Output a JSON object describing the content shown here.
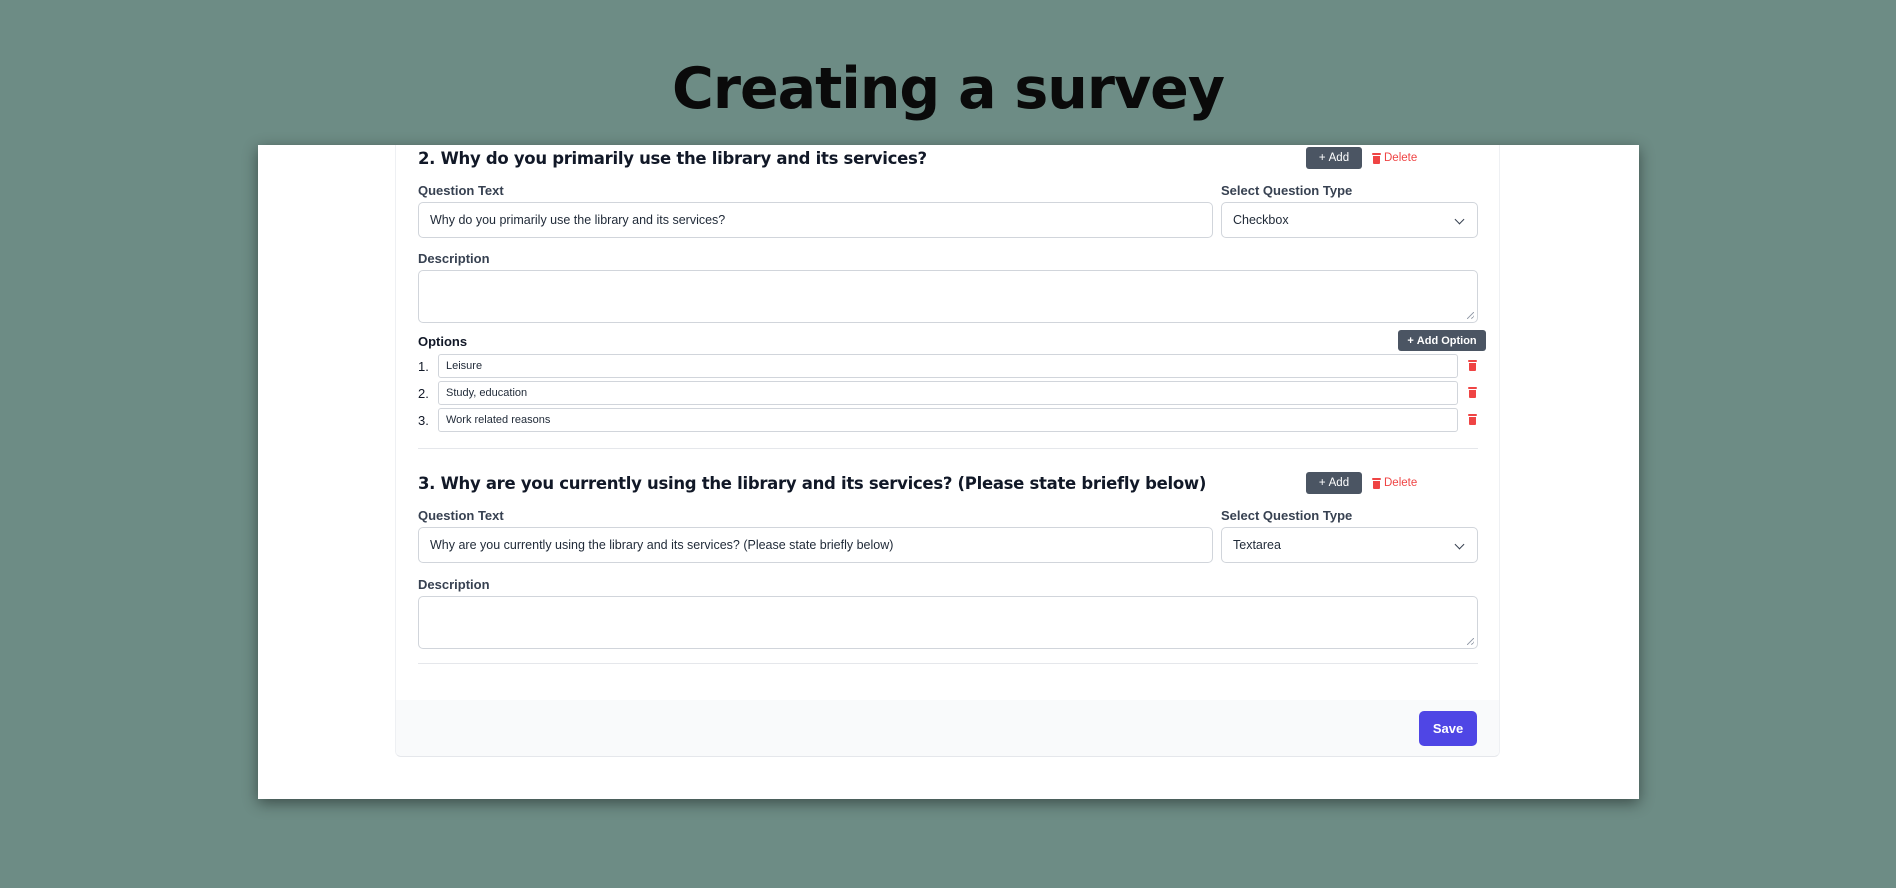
{
  "page": {
    "heading": "Creating a survey"
  },
  "questions": [
    {
      "title": "2. Why do you primarily use the library and its services?",
      "add_label": "Add",
      "delete_label": "Delete",
      "question_text_label": "Question Text",
      "question_text_value": "Why do you primarily use the library and its services?",
      "type_label": "Select Question Type",
      "type_value": "Checkbox",
      "description_label": "Description",
      "options_label": "Options",
      "add_option_label": "Add Option",
      "options": [
        {
          "num": "1.",
          "value": "Leisure"
        },
        {
          "num": "2.",
          "value": "Study, education"
        },
        {
          "num": "3.",
          "value": "Work related reasons"
        }
      ]
    },
    {
      "title": "3. Why are you currently using the library and its services? (Please state briefly below)",
      "add_label": "Add",
      "delete_label": "Delete",
      "question_text_label": "Question Text",
      "question_text_value": "Why are you currently using the library and its services? (Please state briefly below)",
      "type_label": "Select Question Type",
      "type_value": "Textarea",
      "description_label": "Description"
    }
  ],
  "footer": {
    "save_label": "Save"
  },
  "colors": {
    "background": "#6d8c85",
    "primary": "#4f46e5",
    "danger": "#ef4444",
    "dark_button": "#4b5563"
  },
  "icons": {
    "plus": "plus-icon",
    "trash": "trash-icon",
    "chevron": "chevron-down-icon"
  }
}
